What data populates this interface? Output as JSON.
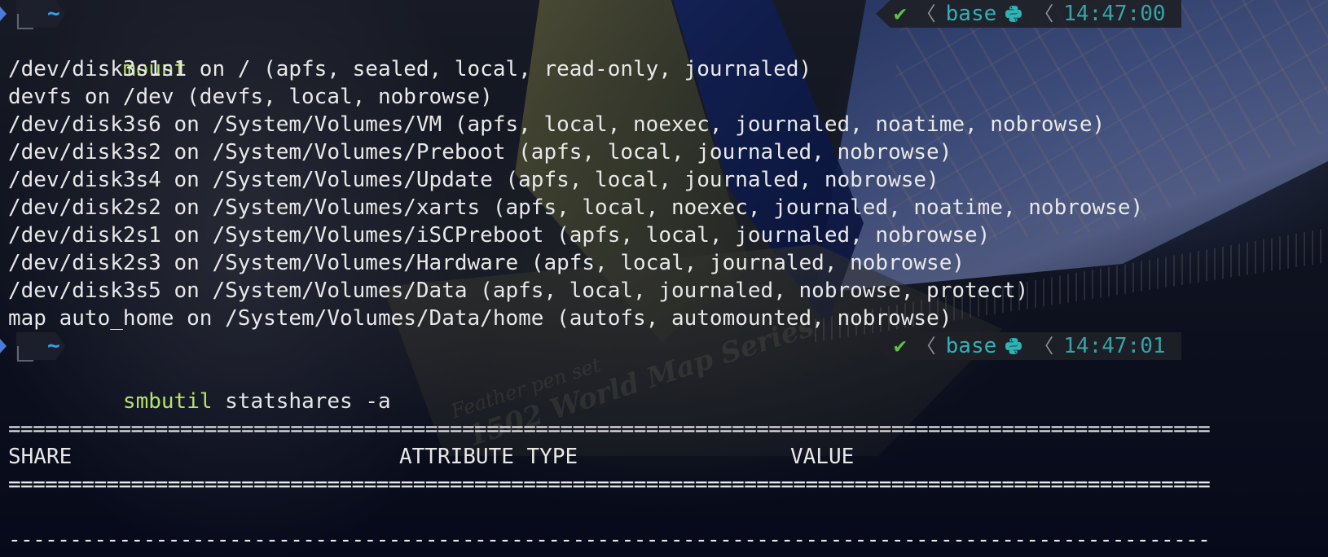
{
  "prompt1": {
    "path": "~",
    "status": {
      "check": "✔",
      "env": "base",
      "time": "14:47:00"
    },
    "command": {
      "name": "mount",
      "args": ""
    }
  },
  "mount_output": [
    "/dev/disk3s1s1 on / (apfs, sealed, local, read-only, journaled)",
    "devfs on /dev (devfs, local, nobrowse)",
    "/dev/disk3s6 on /System/Volumes/VM (apfs, local, noexec, journaled, noatime, nobrowse)",
    "/dev/disk3s2 on /System/Volumes/Preboot (apfs, local, journaled, nobrowse)",
    "/dev/disk3s4 on /System/Volumes/Update (apfs, local, journaled, nobrowse)",
    "/dev/disk2s2 on /System/Volumes/xarts (apfs, local, noexec, journaled, noatime, nobrowse)",
    "/dev/disk2s1 on /System/Volumes/iSCPreboot (apfs, local, journaled, nobrowse)",
    "/dev/disk2s3 on /System/Volumes/Hardware (apfs, local, journaled, nobrowse)",
    "/dev/disk3s5 on /System/Volumes/Data (apfs, local, journaled, nobrowse, protect)",
    "map auto_home on /System/Volumes/Data/home (autofs, automounted, nobrowse)"
  ],
  "prompt2": {
    "path": "~",
    "status": {
      "check": "✔",
      "env": "base",
      "time": "14:47:01"
    },
    "command": {
      "name": "smbutil",
      "args": " statshares -a"
    }
  },
  "statshares": {
    "rule_double": "==================================================================================================",
    "rule_single": "--------------------------------------------------------------------------------------------------",
    "columns": {
      "share": "SHARE",
      "attribute_type": "ATTRIBUTE TYPE",
      "value": "VALUE"
    }
  },
  "background_caption": {
    "line1": "Feather pen set",
    "line2": "1502 World Map Series"
  },
  "colors": {
    "path": "#2ea6e8",
    "command": "#b4e36a",
    "check": "#5ec14a",
    "env": "#2fb2b6",
    "time": "#37a3a7",
    "text": "#e8e8e8"
  },
  "icons": {
    "status_check": "check-icon",
    "status_separator": "angle-left-icon",
    "env_icon": "python-icon"
  }
}
